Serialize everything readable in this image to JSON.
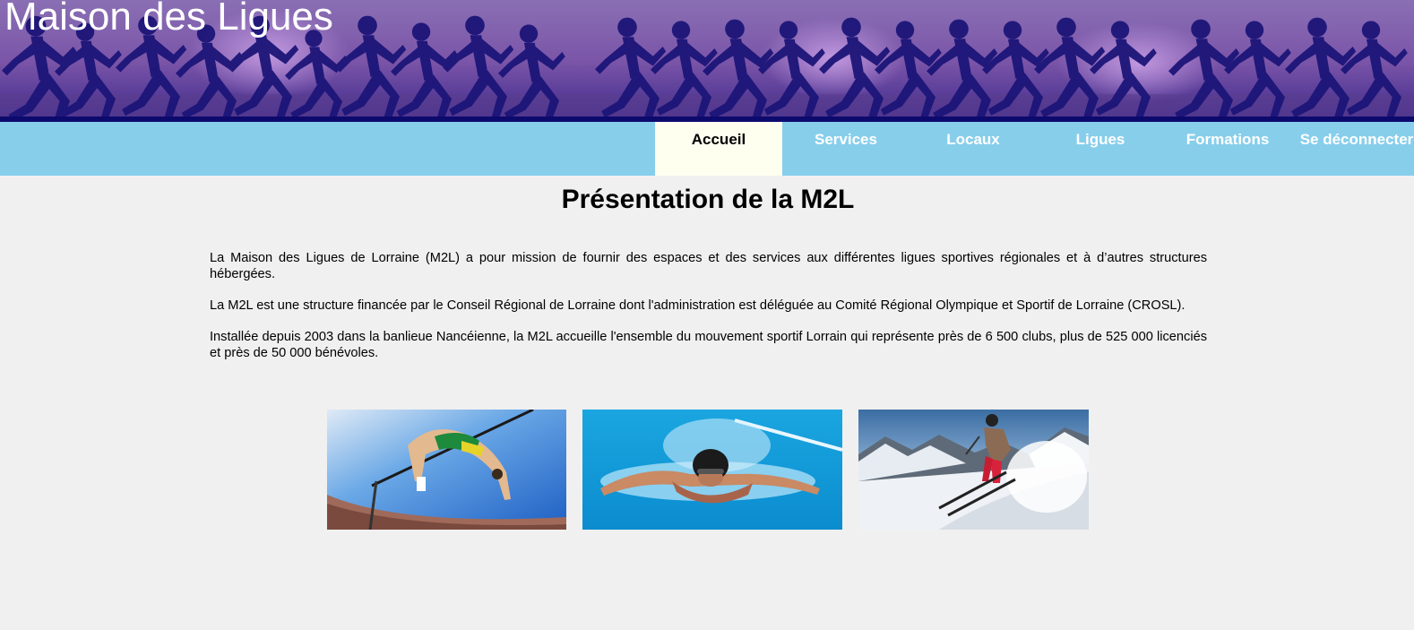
{
  "header": {
    "site_title": "Maison des Ligues"
  },
  "nav": {
    "items": [
      {
        "label": "Accueil",
        "active": true
      },
      {
        "label": "Services",
        "active": false
      },
      {
        "label": "Locaux",
        "active": false
      },
      {
        "label": "Ligues",
        "active": false
      },
      {
        "label": "Formations",
        "active": false
      },
      {
        "label": "Se déconnecter",
        "active": false
      }
    ]
  },
  "main": {
    "title": "Présentation de la M2L",
    "paragraphs": [
      "La Maison des Ligues de Lorraine (M2L) a pour mission de fournir des espaces et des services aux différentes ligues sportives régionales et à d’autres structures hébergées.",
      "La M2L est une structure financée par le Conseil Régional de Lorraine dont l'administration est déléguée au Comité Régional Olympique et Sportif de Lorraine (CROSL).",
      "Installée depuis 2003 dans la banlieue Nancéienne, la M2L accueille l'ensemble du mouvement sportif Lorrain qui représente près de 6 500 clubs, plus de 525 000 licenciés et près de 50 000 bénévoles."
    ],
    "photos": [
      {
        "icon": "high-jump-photo"
      },
      {
        "icon": "swimmer-photo"
      },
      {
        "icon": "skier-photo"
      }
    ]
  },
  "colors": {
    "nav_background": "#87ceeb",
    "nav_active_background": "#fffff0",
    "page_background": "#f0f0f0",
    "banner_strip": "#0d0a6e"
  }
}
